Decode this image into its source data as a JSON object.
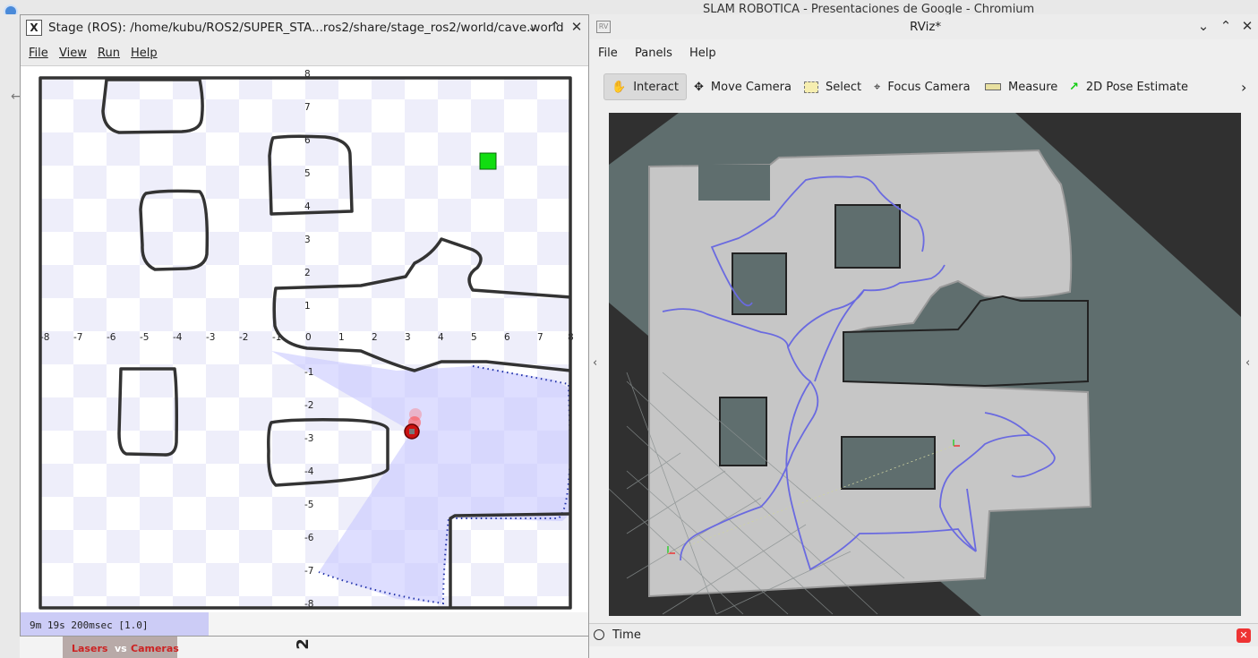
{
  "background": {
    "browser_title": "SLAM ROBOTICA - Presentaciones de Google - Chromium",
    "thumb_left": "Lasers",
    "thumb_vs": "vs",
    "thumb_right": "Cameras",
    "slide_number": "2"
  },
  "stage": {
    "title": "Stage (ROS): /home/kubu/ROS2/SUPER_STA...ros2/share/stage_ros2/world/cave.world",
    "menu": [
      "File",
      "View",
      "Run",
      "Help"
    ],
    "status": "9m 19s 200msec [1.0]",
    "x_ticks": [
      "-8",
      "-7",
      "-6",
      "-5",
      "-4",
      "-3",
      "-2",
      "-1",
      "0",
      "1",
      "2",
      "3",
      "4",
      "5",
      "6",
      "7",
      "8"
    ],
    "y_ticks": [
      "8",
      "7",
      "6",
      "5",
      "4",
      "3",
      "2",
      "1",
      "-1",
      "-2",
      "-3",
      "-4",
      "-5",
      "-6",
      "-7",
      "-8"
    ],
    "colors": {
      "robot": "#cc1111",
      "goal": "#11dd11",
      "laser": "#c8c8ff",
      "walls": "#333333"
    }
  },
  "rviz": {
    "title": "RViz*",
    "menu": [
      "File",
      "Panels",
      "Help"
    ],
    "tools": [
      "Interact",
      "Move Camera",
      "Select",
      "Focus Camera",
      "Measure",
      "2D Pose Estimate"
    ],
    "time_panel": "Time",
    "colors": {
      "path": "#6a6ae0",
      "free": "#c8c8c8",
      "unknown": "#5f6e6e",
      "background": "#303030"
    }
  }
}
